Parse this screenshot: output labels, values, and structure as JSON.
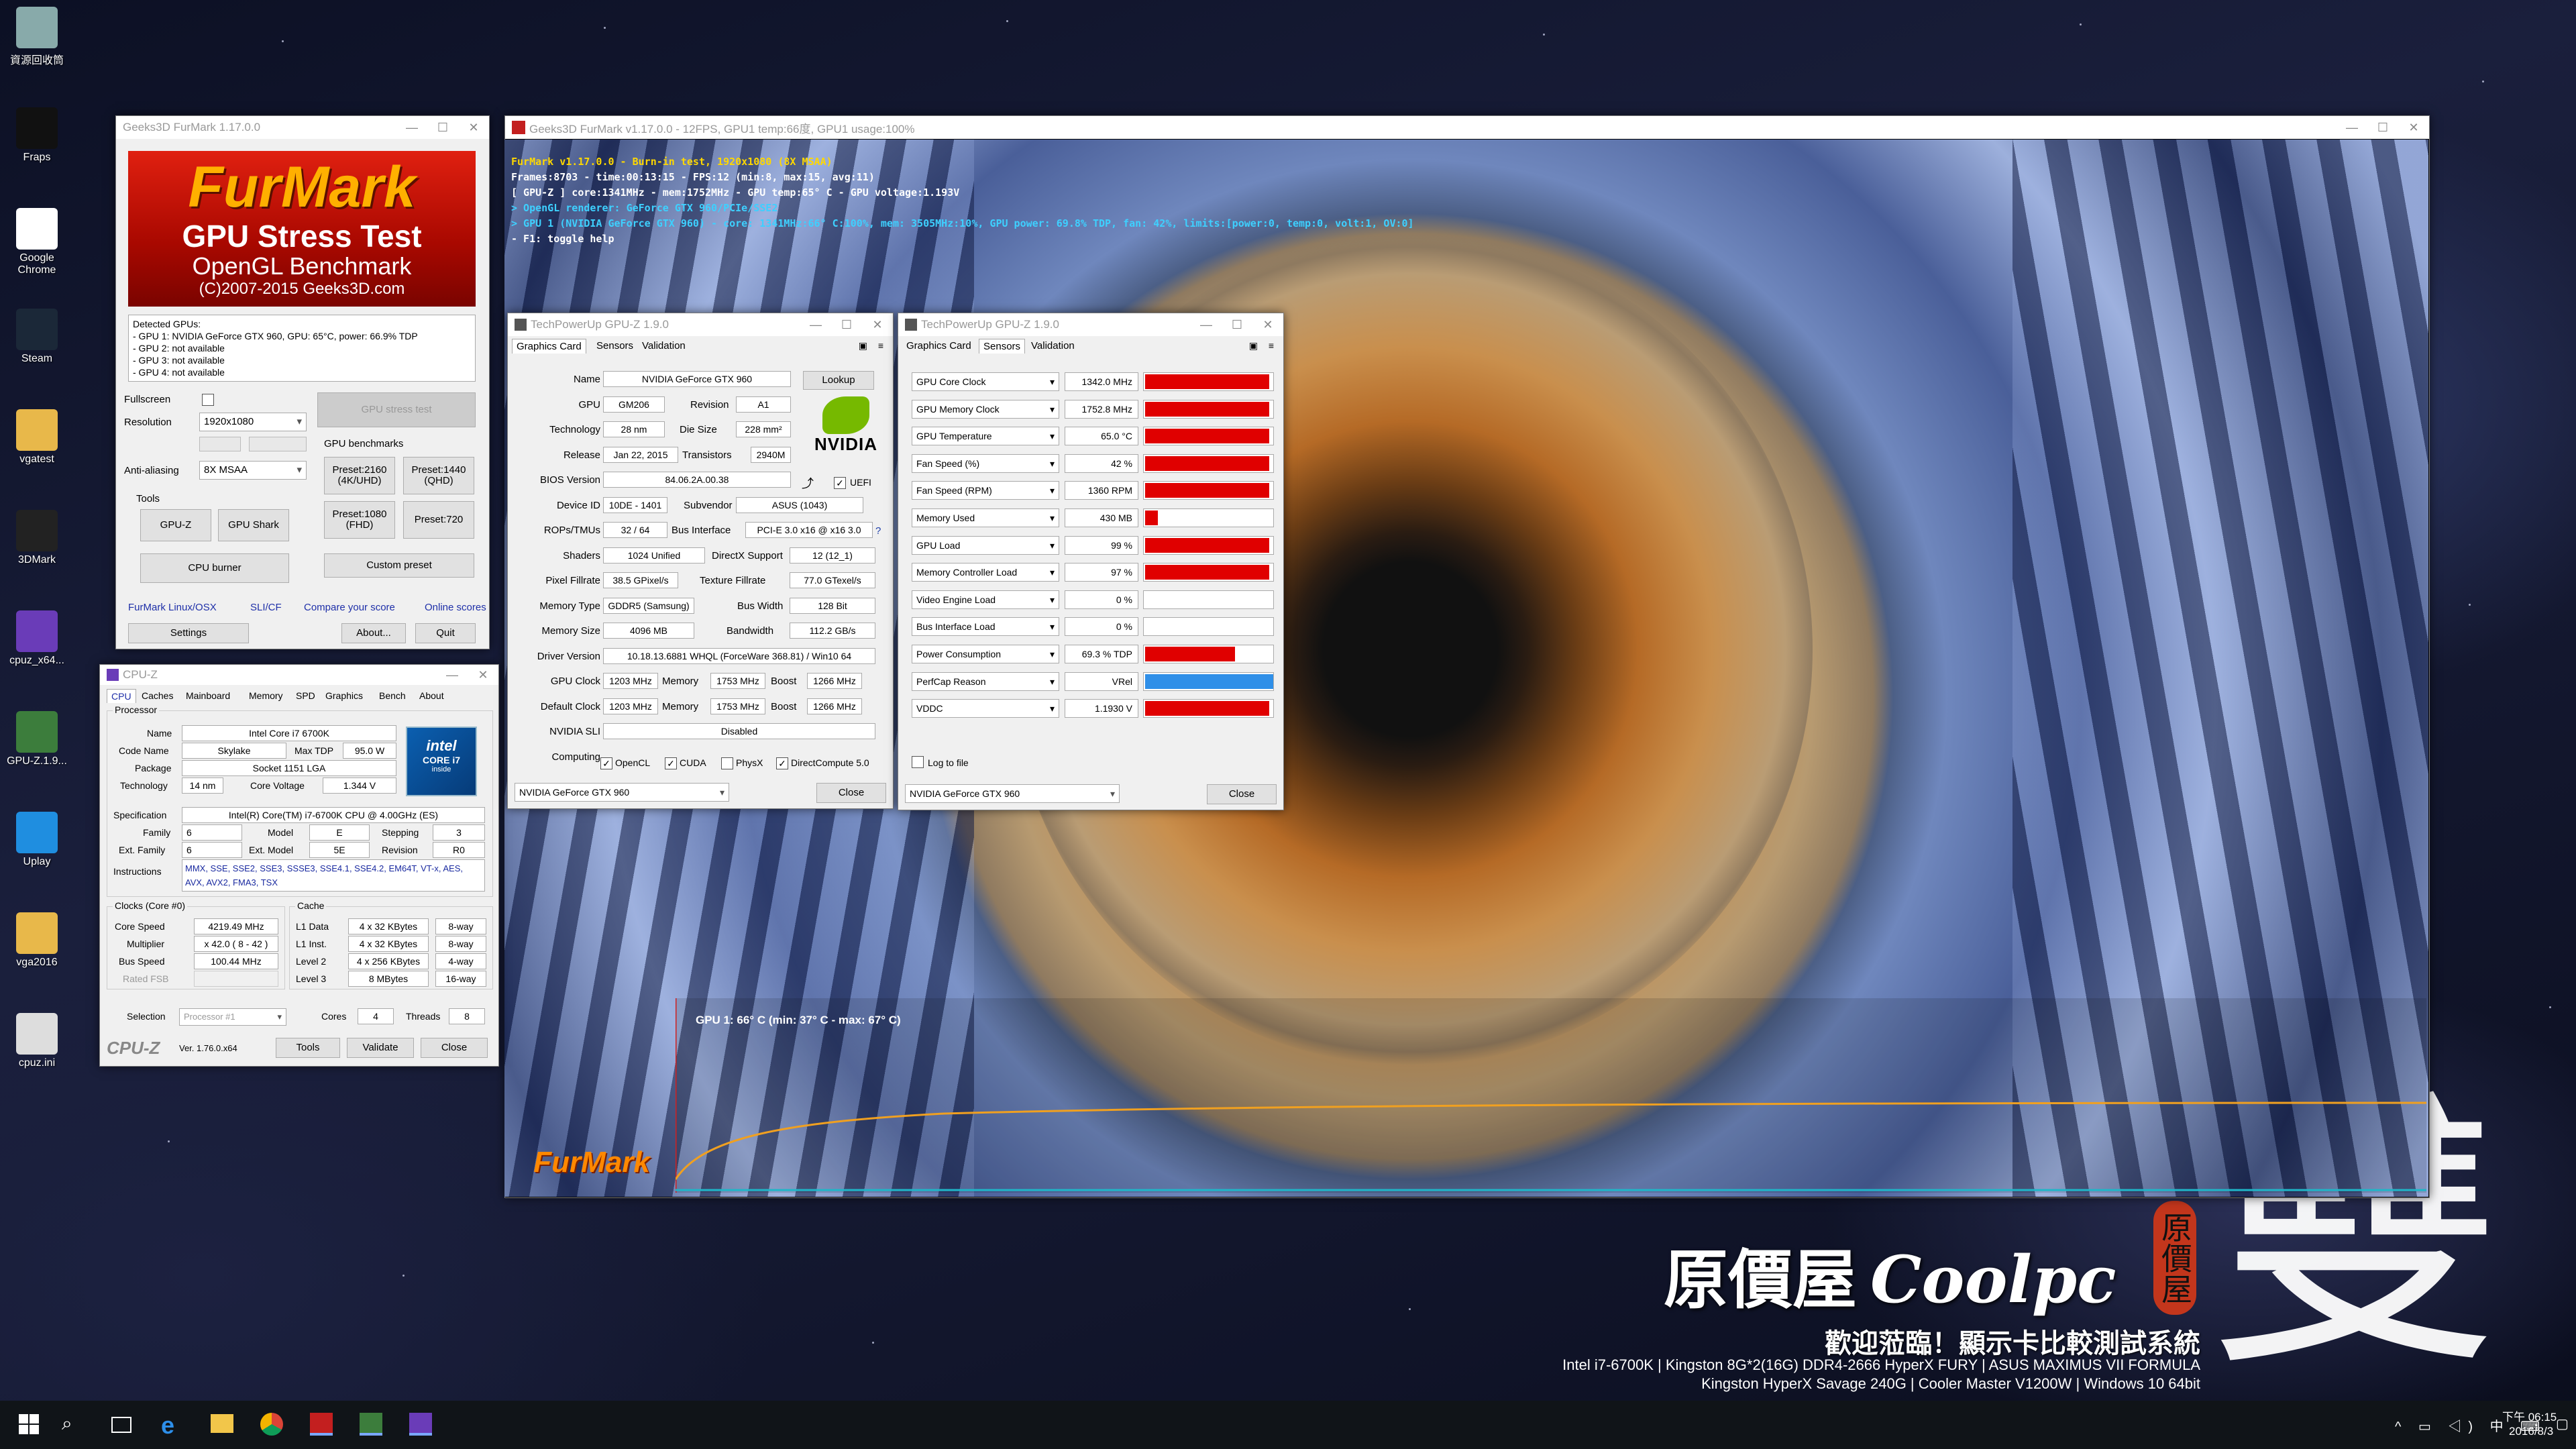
{
  "desktop_icons": [
    {
      "label": "資源回收筒",
      "icon": "recycle-bin-icon"
    },
    {
      "label": "Fraps",
      "icon": "fraps-icon"
    },
    {
      "label": "Google Chrome",
      "icon": "chrome-icon"
    },
    {
      "label": "Steam",
      "icon": "steam-icon"
    },
    {
      "label": "vgatest",
      "icon": "folder-icon"
    },
    {
      "label": "3DMark",
      "icon": "3dmark-icon"
    },
    {
      "label": "cpuz_x64...",
      "icon": "cpuz-icon"
    },
    {
      "label": "GPU-Z.1.9...",
      "icon": "gpuz-icon"
    },
    {
      "label": "Uplay",
      "icon": "uplay-icon"
    },
    {
      "label": "vga2016",
      "icon": "folder-icon"
    },
    {
      "label": "cpuz.ini",
      "icon": "ini-file-icon"
    }
  ],
  "furmark_main": {
    "title": "Geeks3D FurMark 1.17.0.0",
    "logo_line1": "FurMark",
    "logo_line2": "GPU Stress Test",
    "logo_line3": "OpenGL Benchmark",
    "logo_line4": "(C)2007-2015 Geeks3D.com",
    "detected_title": "Detected GPUs:",
    "gpus": [
      "- GPU 1: NVIDIA GeForce GTX 960, GPU: 65°C, power: 66.9% TDP",
      "- GPU 2: not available",
      "- GPU 3: not available",
      "- GPU 4: not available"
    ],
    "fullscreen_label": "Fullscreen",
    "resolution_label": "Resolution",
    "resolution_value": "1920x1080",
    "aa_label": "Anti-aliasing",
    "aa_value": "8X MSAA",
    "tools_label": "Tools",
    "gpu_stress_test": "GPU stress test",
    "benchmarks_label": "GPU benchmarks",
    "preset_2160": "Preset:2160\n(4K/UHD)",
    "preset_1440": "Preset:1440\n(QHD)",
    "preset_1080": "Preset:1080\n(FHD)",
    "preset_720": "Preset:720",
    "gpuz_btn": "GPU-Z",
    "gpushark_btn": "GPU Shark",
    "cpuburner_btn": "CPU burner",
    "custom_preset_btn": "Custom preset",
    "link_linux": "FurMark Linux/OSX",
    "link_sli": "SLI/CF",
    "link_compare": "Compare your score",
    "link_online": "Online scores",
    "settings_btn": "Settings",
    "about_btn": "About...",
    "quit_btn": "Quit"
  },
  "cpuz": {
    "title": "CPU-Z",
    "tabs": [
      "CPU",
      "Caches",
      "Mainboard",
      "Memory",
      "SPD",
      "Graphics",
      "Bench",
      "About"
    ],
    "processor_label": "Processor",
    "name_k": "Name",
    "name": "Intel Core i7 6700K",
    "codename_k": "Code Name",
    "codename": "Skylake",
    "maxtdp_k": "Max TDP",
    "maxtdp": "95.0 W",
    "package_k": "Package",
    "package": "Socket 1151 LGA",
    "technology_k": "Technology",
    "technology": "14 nm",
    "corevoltage_k": "Core Voltage",
    "corevoltage": "1.344 V",
    "spec_k": "Specification",
    "spec": "Intel(R) Core(TM) i7-6700K CPU @ 4.00GHz (ES)",
    "family_k": "Family",
    "family": "6",
    "model_k": "Model",
    "model": "E",
    "stepping_k": "Stepping",
    "stepping": "3",
    "extfamily_k": "Ext. Family",
    "extfamily": "6",
    "extmodel_k": "Ext. Model",
    "extmodel": "5E",
    "revision_k": "Revision",
    "revision": "R0",
    "instructions_k": "Instructions",
    "instructions": "MMX, SSE, SSE2, SSE3, SSSE3, SSE4.1, SSE4.2, EM64T, VT-x, AES, AVX, AVX2, FMA3, TSX",
    "clocks_label": "Clocks (Core #0)",
    "corespeed_k": "Core Speed",
    "corespeed": "4219.49 MHz",
    "multiplier_k": "Multiplier",
    "multiplier": "x 42.0 ( 8 - 42 )",
    "busspeed_k": "Bus Speed",
    "busspeed": "100.44 MHz",
    "ratedfsb_k": "Rated FSB",
    "cache_label": "Cache",
    "l1d_k": "L1 Data",
    "l1d": "4 x 32 KBytes",
    "l1d_w": "8-way",
    "l1i_k": "L1 Inst.",
    "l1i": "4 x 32 KBytes",
    "l1i_w": "8-way",
    "l2_k": "Level 2",
    "l2": "4 x 256 KBytes",
    "l2_w": "4-way",
    "l3_k": "Level 3",
    "l3": "8 MBytes",
    "l3_w": "16-way",
    "selection_k": "Selection",
    "selection": "Processor #1",
    "cores_k": "Cores",
    "cores": "4",
    "threads_k": "Threads",
    "threads": "8",
    "brand": "CPU-Z",
    "version": "Ver. 1.76.0.x64",
    "tools_btn": "Tools",
    "validate_btn": "Validate",
    "close_btn": "Close",
    "intel_badge1": "intel",
    "intel_badge2": "CORE i7",
    "intel_badge3": "inside"
  },
  "furmark_render": {
    "title": "Geeks3D FurMark v1.17.0.0 - 12FPS, GPU1 temp:66度, GPU1 usage:100%",
    "osd": [
      "FurMark v1.17.0.0 - Burn-in test, 1920x1080 (8X MSAA)",
      "Frames:8703 - time:00:13:15 - FPS:12 (min:8, max:15, avg:11)",
      "[ GPU-Z ] core:1341MHz - mem:1752MHz - GPU temp:65° C - GPU voltage:1.193V",
      "> OpenGL renderer: GeForce GTX 960/PCIe/SSE2",
      "> GPU 1 (NVIDIA GeForce GTX 960) - core: 1341MHz:66° C:100%, mem: 3505MHz:10%, GPU power: 69.8% TDP, fan: 42%, limits:[power:0, temp:0, volt:1, OV:0]",
      "- F1: toggle help"
    ],
    "graph_label": "GPU 1: 66° C (min: 37° C - max: 67° C)",
    "watermark": "FurMark"
  },
  "gpuz_card": {
    "title": "TechPowerUp GPU-Z 1.9.0",
    "tabs": [
      "Graphics Card",
      "Sensors",
      "Validation"
    ],
    "rows": [
      {
        "k": "Name",
        "v": "NVIDIA GeForce GTX 960"
      },
      {
        "k": "GPU",
        "v": "GM206"
      },
      {
        "k": "Technology",
        "v": "28 nm"
      },
      {
        "k": "Release",
        "v": "Jan 22, 2015"
      },
      {
        "k": "BIOS Version",
        "v": "84.06.2A.00.38"
      },
      {
        "k": "Device ID",
        "v": "10DE - 1401"
      },
      {
        "k": "ROPs/TMUs",
        "v": "32 / 64"
      },
      {
        "k": "Shaders",
        "v": "1024 Unified"
      },
      {
        "k": "Pixel Fillrate",
        "v": "38.5 GPixel/s"
      },
      {
        "k": "Memory Type",
        "v": "GDDR5 (Samsung)"
      },
      {
        "k": "Memory Size",
        "v": "4096 MB"
      },
      {
        "k": "Driver Version",
        "v": "10.18.13.6881 WHQL (ForceWare 368.81) / Win10 64"
      },
      {
        "k": "GPU Clock",
        "v": "1203 MHz"
      },
      {
        "k": "Default Clock",
        "v": "1203 MHz"
      },
      {
        "k": "NVIDIA SLI",
        "v": "Disabled"
      },
      {
        "k": "Computing",
        "v": ""
      }
    ],
    "revision_k": "Revision",
    "revision": "A1",
    "diesize_k": "Die Size",
    "diesize": "228 mm²",
    "transistors_k": "Transistors",
    "transistors": "2940M",
    "subvendor_k": "Subvendor",
    "subvendor": "ASUS (1043)",
    "businterface_k": "Bus Interface",
    "businterface": "PCI-E 3.0 x16 @ x16 3.0",
    "directx_k": "DirectX Support",
    "directx": "12 (12_1)",
    "texfill_k": "Texture Fillrate",
    "texfill": "77.0 GTexel/s",
    "buswidth_k": "Bus Width",
    "buswidth": "128 Bit",
    "bandwidth_k": "Bandwidth",
    "bandwidth": "112.2 GB/s",
    "mem_k": "Memory",
    "gpuclock_mem": "1753 MHz",
    "default_mem": "1753 MHz",
    "boost_k": "Boost",
    "gpuclock_boost": "1266 MHz",
    "default_boost": "1266 MHz",
    "uefi": "UEFI",
    "opencl": "OpenCL",
    "cuda": "CUDA",
    "physx": "PhysX",
    "directcompute": "DirectCompute 5.0",
    "lookup_btn": "Lookup",
    "nvidia_logo": "NVIDIA",
    "gpu_select": "NVIDIA GeForce GTX 960",
    "close_btn": "Close",
    "help": "?"
  },
  "gpuz_sensors": {
    "title": "TechPowerUp GPU-Z 1.9.0",
    "tabs": [
      "Graphics Card",
      "Sensors",
      "Validation"
    ],
    "rows": [
      {
        "name": "GPU Core Clock",
        "value": "1342.0 MHz",
        "level": 0.97,
        "color": "#e00000"
      },
      {
        "name": "GPU Memory Clock",
        "value": "1752.8 MHz",
        "level": 0.97,
        "color": "#e00000"
      },
      {
        "name": "GPU Temperature",
        "value": "65.0 °C",
        "level": 0.97,
        "color": "#e00000"
      },
      {
        "name": "Fan Speed (%)",
        "value": "42 %",
        "level": 0.97,
        "color": "#e00000"
      },
      {
        "name": "Fan Speed (RPM)",
        "value": "1360 RPM",
        "level": 0.97,
        "color": "#e00000"
      },
      {
        "name": "Memory Used",
        "value": "430 MB",
        "level": 0.1,
        "color": "#e00000"
      },
      {
        "name": "GPU Load",
        "value": "99 %",
        "level": 0.97,
        "color": "#e00000"
      },
      {
        "name": "Memory Controller Load",
        "value": "97 %",
        "level": 0.97,
        "color": "#e00000"
      },
      {
        "name": "Video Engine Load",
        "value": "0 %",
        "level": 0,
        "color": "#e00000"
      },
      {
        "name": "Bus Interface Load",
        "value": "0 %",
        "level": 0,
        "color": "#e00000"
      },
      {
        "name": "Power Consumption",
        "value": "69.3 % TDP",
        "level": 0.7,
        "color": "#e00000"
      },
      {
        "name": "PerfCap Reason",
        "value": "VRel",
        "level": 1.0,
        "color": "#2f8fe8"
      },
      {
        "name": "VDDC",
        "value": "1.1930 V",
        "level": 0.97,
        "color": "#e00000"
      }
    ],
    "logtofile": "Log to file",
    "gpu_select": "NVIDIA GeForce GTX 960",
    "close_btn": "Close"
  },
  "wallpaper": {
    "brand_cn": "原價屋",
    "brand_en": "Coolpc",
    "welcome": "歡迎蒞臨！顯示卡比較測試系統",
    "spec1": "Intel i7-6700K | Kingston 8G*2(16G) DDR4-2666 HyperX FURY | ASUS MAXIMUS VII FORMULA",
    "spec2": "Kingston HyperX Savage 240G | Cooler Master V1200W | Windows 10 64bit",
    "seal": "原價屋",
    "big_char": "雙"
  },
  "taskbar": {
    "time_period": "下午 06:15",
    "date": "2016/8/3"
  }
}
